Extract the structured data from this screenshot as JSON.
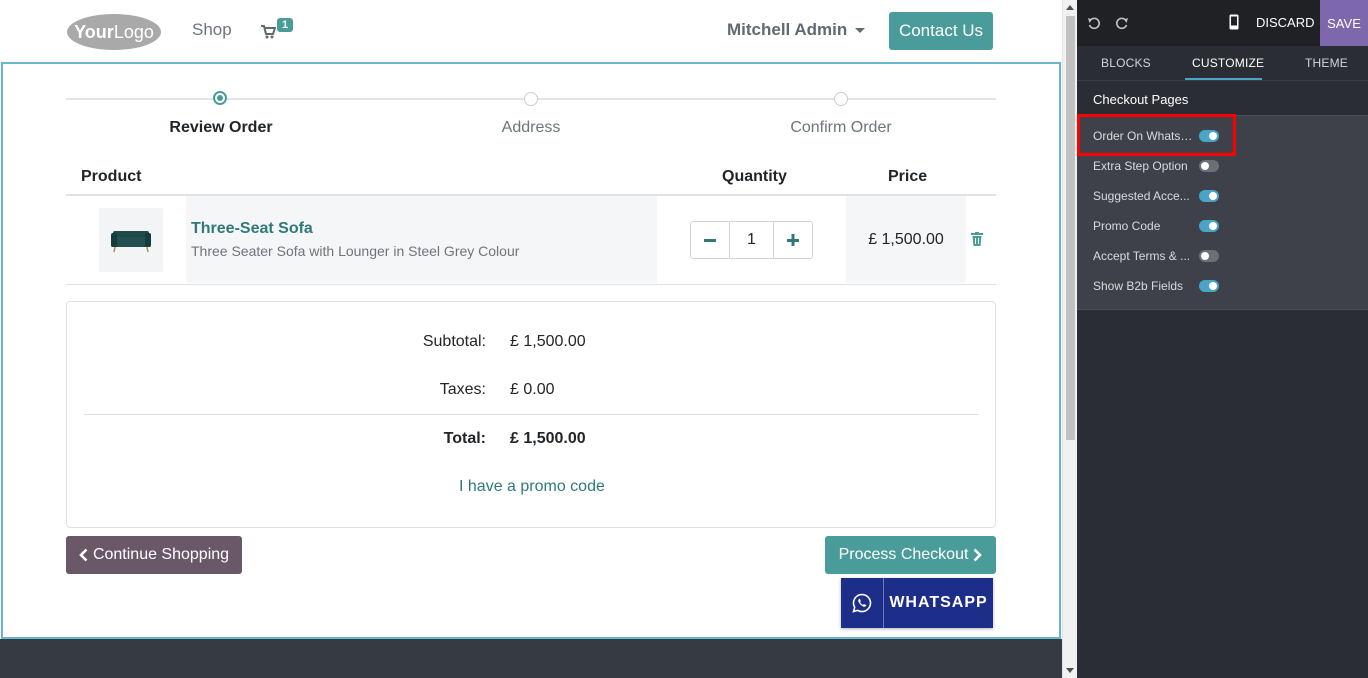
{
  "header": {
    "logo_text": "YourLogo",
    "nav_shop": "Shop",
    "cart_count": "1",
    "user_name": "Mitchell Admin",
    "contact_button": "Contact Us"
  },
  "wizard": {
    "steps": [
      "Review Order",
      "Address",
      "Confirm Order"
    ],
    "active_step": 0
  },
  "cart_table": {
    "columns": [
      "Product",
      "Quantity",
      "Price"
    ],
    "rows": [
      {
        "name": "Three-Seat Sofa",
        "description": "Three Seater Sofa with Lounger in Steel Grey Colour",
        "quantity": "1",
        "price": "£ 1,500.00"
      }
    ]
  },
  "totals": {
    "subtotal_label": "Subtotal:",
    "subtotal_value": "£ 1,500.00",
    "taxes_label": "Taxes:",
    "taxes_value": "£ 0.00",
    "total_label": "Total:",
    "total_value": "£ 1,500.00",
    "promo_link": "I have a promo code"
  },
  "actions": {
    "continue_shopping": "Continue Shopping",
    "process_checkout": "Process Checkout",
    "whatsapp": "WHATSAPP"
  },
  "editor": {
    "discard": "DISCARD",
    "save": "SAVE",
    "tabs": [
      "BLOCKS",
      "CUSTOMIZE",
      "THEME"
    ],
    "active_tab": "CUSTOMIZE",
    "section_title": "Checkout Pages",
    "options": [
      {
        "label": "Order On Whatsa...",
        "enabled": true
      },
      {
        "label": "Extra Step Option",
        "enabled": false
      },
      {
        "label": "Suggested Acce...",
        "enabled": true
      },
      {
        "label": "Promo Code",
        "enabled": true
      },
      {
        "label": "Accept Terms & ...",
        "enabled": false
      },
      {
        "label": "Show B2b Fields",
        "enabled": true
      }
    ]
  },
  "colors": {
    "primary": "#4a9c9a",
    "secondary": "#6a5868",
    "whatsapp": "#1d2d8a",
    "editor_accent": "#4aa4c5",
    "save": "#7d67ad",
    "highlight": "#ff0000"
  }
}
